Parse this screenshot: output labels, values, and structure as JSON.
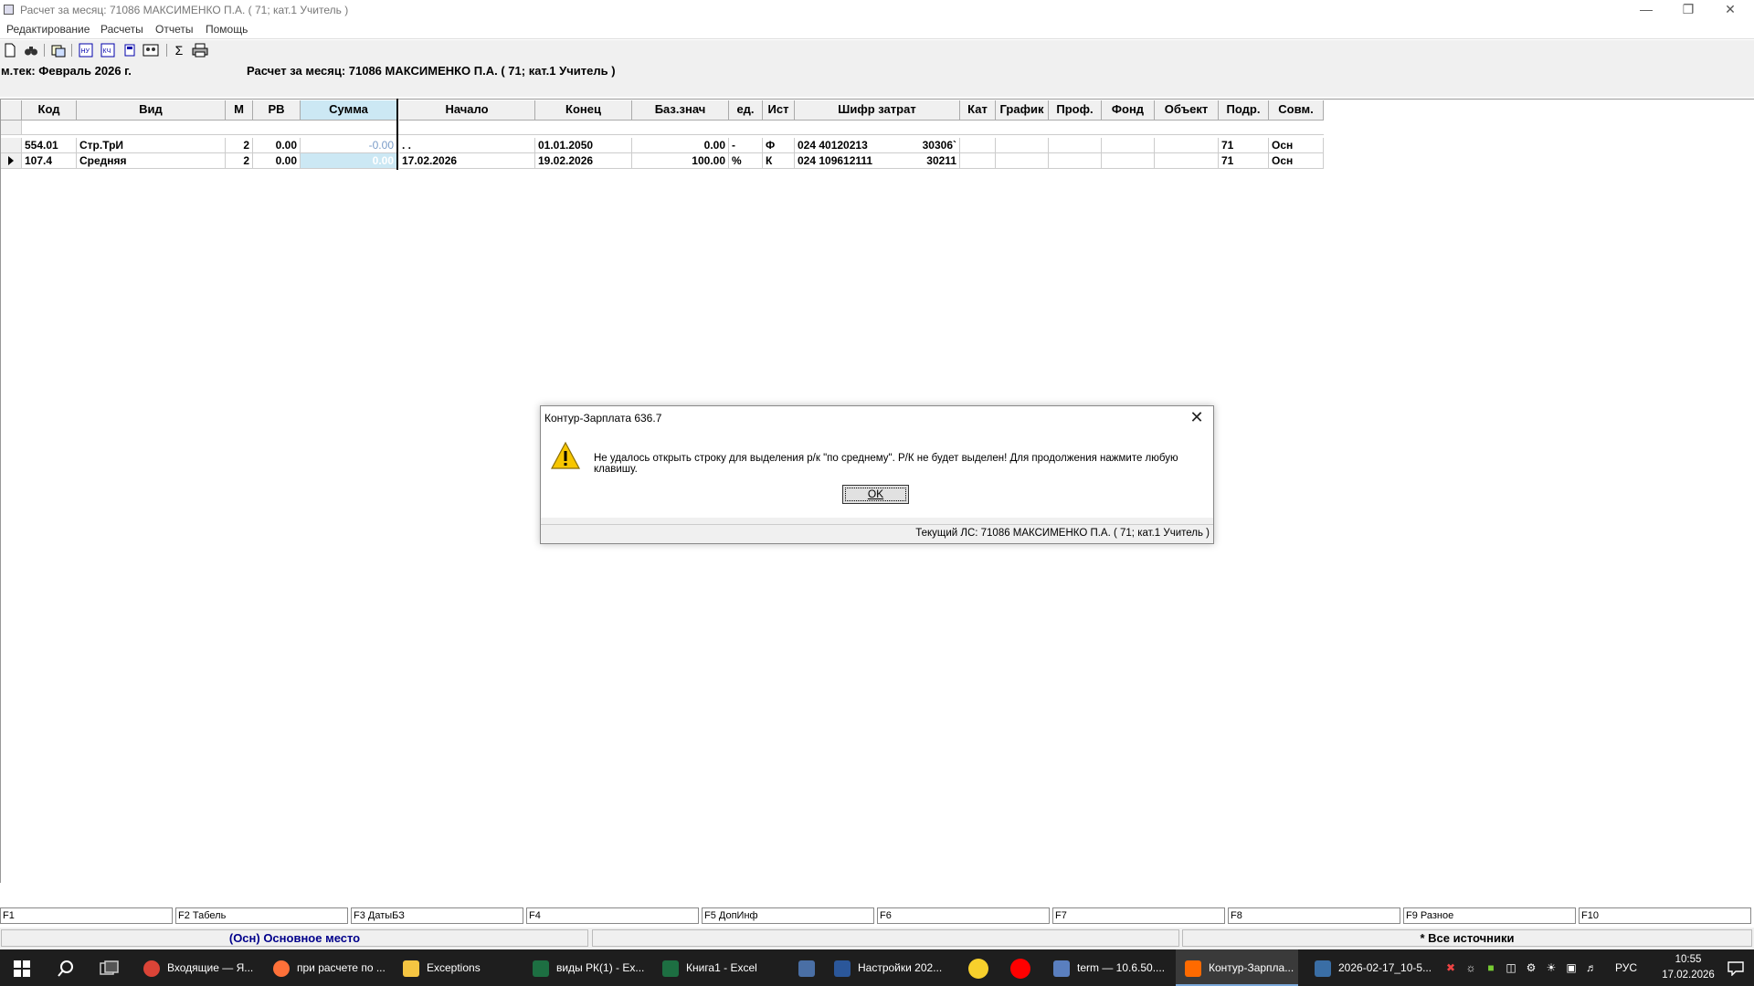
{
  "window": {
    "title": "Расчет за месяц: 71086 МАКСИМЕНКО П.А. ( 71; кат.1 Учитель )"
  },
  "menu": [
    "Редактирование",
    "Расчеты",
    "Отчеты",
    "Помощь"
  ],
  "toolbar_icons": [
    "new-doc-icon",
    "binoculars-icon",
    "copy-icon",
    "hu-icon",
    "ku-icon",
    "calc-icon",
    "people-icon",
    "sigma-icon",
    "printer-icon"
  ],
  "header": {
    "period": "м.тек: Февраль 2026 г.",
    "calc_title": "Расчет за месяц:  71086 МАКСИМЕНКО П.А. ( 71; кат.1 Учитель )"
  },
  "grid": {
    "columns": [
      "Код",
      "Вид",
      "М",
      "РВ",
      "Сумма",
      "Начало",
      "Конец",
      "Баз.знач",
      "ед.",
      "Ист",
      "Шифр затрат",
      "Кат",
      "График",
      "Проф.",
      "Фонд",
      "Объект",
      "Подр.",
      "Совм."
    ],
    "rows": [
      {
        "kod": "554.01",
        "vid": "Стр.ТрИ",
        "m": "2",
        "rv": "0.00",
        "summa": "-0.00",
        "nachalo": " .  .",
        "konec": "01.01.2050",
        "baz": "0.00",
        "ed": "-",
        "ist": "Ф",
        "shifr1": "024 40120213",
        "shifr2": "30306`",
        "podr": "71",
        "sovm": "Осн"
      },
      {
        "kod": "107.4",
        "vid": "Средняя",
        "m": "2",
        "rv": "0.00",
        "summa": "0.00",
        "nachalo": "17.02.2026",
        "konec": "19.02.2026",
        "baz": "100.00",
        "ed": "%",
        "ist": "К",
        "shifr1": "024 109612111",
        "shifr2": "30211",
        "podr": "71",
        "sovm": "Осн"
      }
    ]
  },
  "dialog": {
    "title": "Контур-Зарплата 636.7",
    "message": "Не удалось открыть строку для выделения р/к \"по среднему\". Р/К не будет выделен! Для продолжения нажмите любую клавишу.",
    "ok_label": "OK",
    "status": "Текущий ЛС: 71086 МАКСИМЕНКО П.А. ( 71; кат.1 Учитель )"
  },
  "fkeys": [
    "F1",
    "F2 Табель",
    "F3 ДатыБЗ",
    "F4",
    "F5 ДопИнф",
    "F6",
    "F7",
    "F8",
    "F9 Разное",
    "F10"
  ],
  "status": {
    "left": "(Осн) Основное место",
    "middle": "",
    "right": "* Все источники",
    "left_color": "#00008b"
  },
  "taskbar": {
    "apps": [
      {
        "label": "Входящие — Я...",
        "icon": "chrome-icon",
        "color": "#db4437"
      },
      {
        "label": "при расчете по ...",
        "icon": "firefox-icon",
        "color": "#ff7139"
      },
      {
        "label": "Exceptions",
        "icon": "folder-icon",
        "color": "#f5c542"
      },
      {
        "label": "виды РК(1) - Ex...",
        "icon": "excel-icon",
        "color": "#1d6f42"
      },
      {
        "label": "Книга1 - Excel",
        "icon": "excel-icon",
        "color": "#1d6f42"
      },
      {
        "label": "",
        "icon": "calculator-icon",
        "color": "#4a6fa5"
      },
      {
        "label": "Настройки 202...",
        "icon": "word-icon",
        "color": "#2b579a"
      },
      {
        "label": "",
        "icon": "1c-icon",
        "color": "#f7d02c"
      },
      {
        "label": "",
        "icon": "yandex-icon",
        "color": "#ff0000"
      },
      {
        "label": "term — 10.6.50....",
        "icon": "terminal-icon",
        "color": "#5a7fbf"
      },
      {
        "label": "Контур-Зарпла...",
        "icon": "kontur-icon",
        "color": "#ff6a00"
      },
      {
        "label": "2026-02-17_10-5...",
        "icon": "image-icon",
        "color": "#3a6ea5"
      }
    ],
    "lang": "РУС",
    "time": "10:55",
    "date": "17.02.2026"
  }
}
